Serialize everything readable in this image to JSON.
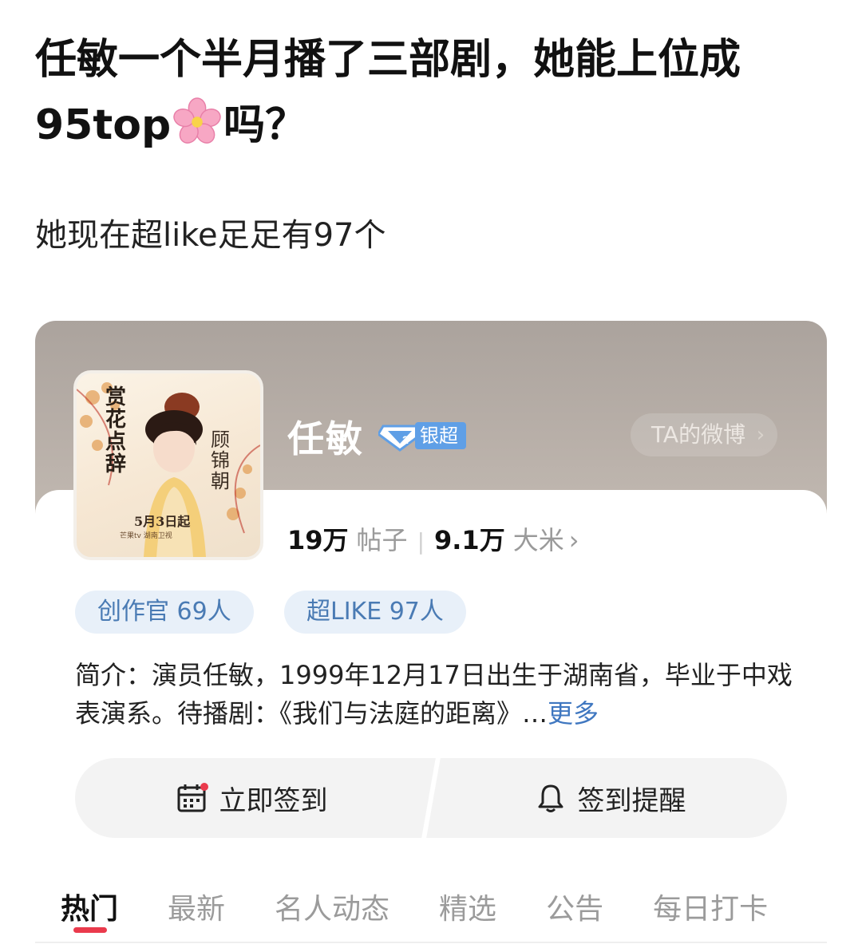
{
  "post": {
    "title_part1": "任敏一个半月播了三部剧，她能上位成95top",
    "title_part2": "吗？",
    "body": "她现在超like足足有97个"
  },
  "topic_card": {
    "name": "任敏",
    "level_badge": "银超",
    "ta_weibo_button": "TA的微博",
    "cover": {
      "title_text": "赏花点辞",
      "role_text": "顾锦朝",
      "date_text": "5月3日起",
      "platform_text": "芒果tv 湖南卫视"
    },
    "stats": {
      "posts_count": "19万",
      "posts_label": "帖子",
      "rice_count": "9.1万",
      "rice_label": "大米"
    },
    "chips": {
      "creator": "创作官 69人",
      "superlike": "超LIKE 97人"
    },
    "intro": {
      "text": "简介：演员任敏，1999年12月17日出生于湖南省，毕业于中戏表演系。待播剧：《我们与法庭的距离》…",
      "more": "更多"
    },
    "actions": {
      "checkin": "立即签到",
      "reminder": "签到提醒"
    },
    "tabs": [
      "热门",
      "最新",
      "名人动态",
      "精选",
      "公告",
      "每日打卡"
    ]
  },
  "colors": {
    "accent_red": "#ea3a4c",
    "link_blue": "#3f77c0",
    "chip_bg": "#e8f0f9",
    "badge_blue": "#5f9fe6"
  }
}
